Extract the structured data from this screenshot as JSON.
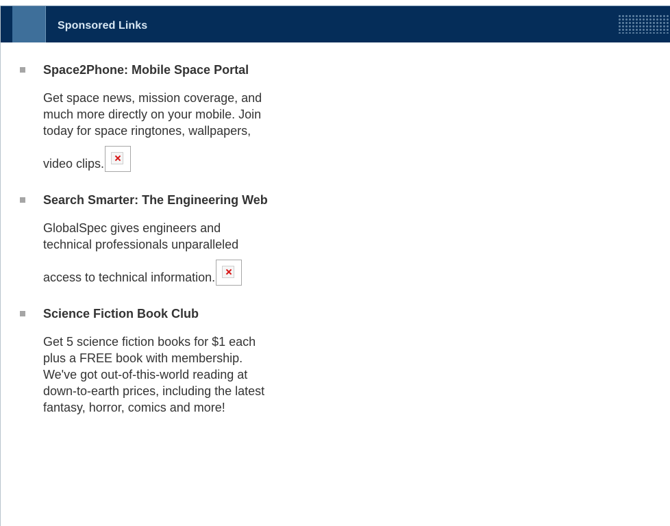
{
  "header": {
    "title": "Sponsored Links"
  },
  "items": [
    {
      "title": "Space2Phone: Mobile Space Portal",
      "desc_lines": [
        "Get space news, mission coverage, and",
        "much more directly on your mobile. Join",
        "today for space ringtones, wallpapers,",
        "video clips."
      ]
    },
    {
      "title": "Search Smarter: The Engineering Web",
      "desc_lines": [
        "GlobalSpec gives engineers and",
        "technical professionals unparalleled",
        "access to technical information."
      ]
    },
    {
      "title": "Science Fiction Book Club",
      "desc_lines": [
        "Get 5 science fiction books for $1 each",
        "plus a FREE book with membership.",
        "We've got out-of-this-world reading at",
        "down-to-earth prices, including the latest",
        "fantasy, horror, comics and more!"
      ]
    }
  ],
  "colors": {
    "header_bg": "#052d59",
    "header_tab": "#3e6f9a",
    "header_title": "#d8e7f3",
    "bullet": "#a5a5a5",
    "text": "#333333"
  }
}
